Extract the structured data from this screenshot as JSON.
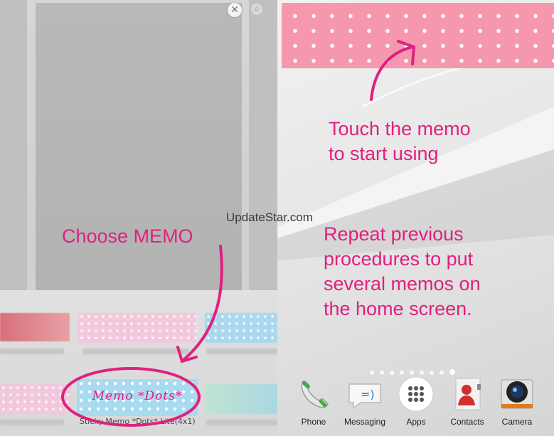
{
  "widget_picker": {
    "memo_thumbnail_text": "Memo *Dots*",
    "memo_thumbnail_caption": "Sticky Memo *Dots* Lite(4x1)",
    "close_icon": "close-icon",
    "page_icon": "home-icon"
  },
  "home_screen": {
    "page_count": 9,
    "active_page": 9,
    "dock": [
      {
        "label": "Phone",
        "icon": "phone-icon"
      },
      {
        "label": "Messaging",
        "icon": "messaging-icon"
      },
      {
        "label": "Apps",
        "icon": "apps-icon"
      },
      {
        "label": "Contacts",
        "icon": "contacts-icon"
      },
      {
        "label": "Camera",
        "icon": "camera-icon"
      }
    ]
  },
  "annotations": {
    "choose": "Choose MEMO",
    "touch_line1": "Touch the memo",
    "touch_line2": "to start using",
    "repeat_line1": "Repeat previous",
    "repeat_line2": "procedures to put",
    "repeat_line3": "several memos on",
    "repeat_line4": "the home screen."
  },
  "watermark": "UpdateStar.com",
  "colors": {
    "annotation": "#e0207f",
    "memo_pink": "#f598ae",
    "memo_blue": "#a8daf0"
  }
}
